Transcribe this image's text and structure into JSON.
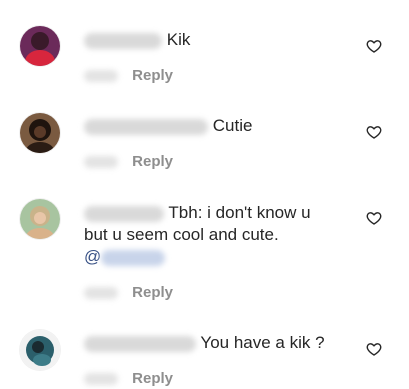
{
  "comments": [
    {
      "text": "Kik",
      "reply_label": "Reply",
      "avatar_color": "#d7263d"
    },
    {
      "text": "Cutie",
      "reply_label": "Reply",
      "avatar_color": "#3b2a20"
    },
    {
      "text_line1": "Tbh: i don't know u",
      "text_line2": "but u seem cool and cute.",
      "mention_prefix": "@",
      "reply_label": "Reply",
      "avatar_color": "#c9b38a"
    },
    {
      "text": "You have a kik ?",
      "reply_label": "Reply",
      "avatar_color": "#2b5f6b"
    }
  ],
  "colors": {
    "text": "#262626",
    "meta": "#8e8e8e",
    "mention": "#385185"
  },
  "icons": {
    "like": "heart-outline-icon"
  }
}
